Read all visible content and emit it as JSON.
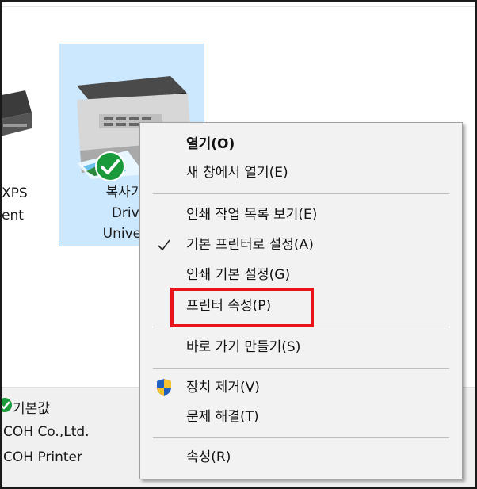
{
  "left_device": {
    "label_lines": [
      "XPS",
      "ent"
    ]
  },
  "device": {
    "name_lines": [
      "복사기Po",
      "Driver",
      "Universa"
    ],
    "status": "default-check-icon"
  },
  "details": {
    "default_label": "기본값",
    "manufacturer": "COH Co.,Ltd.",
    "model": "COH Printer"
  },
  "context_menu": {
    "items": [
      {
        "label": "열기(O)",
        "bold": true
      },
      {
        "label": "새 창에서 열기(E)"
      },
      {
        "label": "인쇄 작업 목록 보기(E)"
      },
      {
        "label": "기본 프린터로 설정(A)",
        "icon": "checkmark-icon"
      },
      {
        "label": "인쇄 기본 설정(G)"
      },
      {
        "label": "프린터 속성(P)",
        "highlighted": true
      },
      {
        "label": "바로 가기 만들기(S)"
      },
      {
        "label": "장치 제거(V)",
        "icon": "uac-shield-icon"
      },
      {
        "label": "문제 해결(T)"
      },
      {
        "label": "속성(R)"
      }
    ]
  },
  "colors": {
    "selection": "#cce8ff",
    "highlight_box": "#e8141a",
    "status_check": "#1a9a3a"
  }
}
